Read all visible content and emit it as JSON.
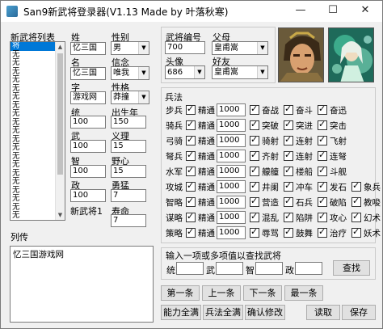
{
  "window": {
    "title": "San9新武将登录器(V1.13 Made by 叶落秋寒)"
  },
  "titlebar": {
    "min": "—",
    "max": "☐",
    "close": "✕"
  },
  "list": {
    "label": "新武将列表",
    "items": [
      "将",
      "无",
      "无",
      "无",
      "无",
      "无",
      "无",
      "无",
      "无",
      "无",
      "无",
      "无",
      "无",
      "无",
      "无",
      "无",
      "无",
      "无",
      "无",
      "无",
      "无",
      "无",
      "无",
      "无",
      "无",
      "无",
      "无",
      "无"
    ]
  },
  "basic": {
    "surname_label": "姓",
    "surname": "忆三国",
    "name_label": "名",
    "name": "忆三国",
    "style_label": "字",
    "style": "游戏网",
    "gender_label": "性别",
    "gender": "男",
    "belief_label": "信念",
    "belief": "唯我",
    "personality_label": "性格",
    "personality": "莽撞",
    "command_label": "统",
    "command": "100",
    "war_label": "武",
    "war": "100",
    "intel_label": "智",
    "intel": "100",
    "politics_label": "政",
    "politics": "100",
    "birth_label": "出生年",
    "birth": "150",
    "righteousness_label": "义理",
    "righteousness": "15",
    "ambition_label": "野心",
    "ambition": "15",
    "bravery_label": "勇猛",
    "bravery": "7",
    "lifespan_label": "寿命",
    "lifespan": "7",
    "general_id_label": "新武将1"
  },
  "codes": {
    "id_label": "武将编号",
    "id": "700",
    "father_label": "父母",
    "father": "皇甫嵩",
    "portrait_label": "头像",
    "portrait": "686",
    "friend_label": "好友",
    "friend": "皇甫嵩"
  },
  "army": {
    "title": "兵法",
    "rows": [
      {
        "unit": "步兵",
        "rank": "精通",
        "value": "1000",
        "s1": "奋战",
        "s2": "奋斗",
        "s3": "奋迅"
      },
      {
        "unit": "骑兵",
        "rank": "精通",
        "value": "1000",
        "s1": "突破",
        "s2": "突进",
        "s3": "突击"
      },
      {
        "unit": "弓骑",
        "rank": "精通",
        "value": "1000",
        "s1": "骑射",
        "s2": "连射",
        "s3": "飞射"
      },
      {
        "unit": "弩兵",
        "rank": "精通",
        "value": "1000",
        "s1": "齐射",
        "s2": "连射",
        "s3": "连弩"
      },
      {
        "unit": "水军",
        "rank": "精通",
        "value": "1000",
        "s1": "艨艟",
        "s2": "楼船",
        "s3": "斗舰"
      },
      {
        "unit": "攻城",
        "rank": "精通",
        "value": "1000",
        "s1": "井阑",
        "s2": "冲车",
        "s3": "发石",
        "s4": "象兵"
      },
      {
        "unit": "智略",
        "rank": "精通",
        "value": "1000",
        "s1": "营造",
        "s2": "石兵",
        "s3": "破陷",
        "s4": "教唆"
      },
      {
        "unit": "谋略",
        "rank": "精通",
        "value": "1000",
        "s1": "混乱",
        "s2": "陷阱",
        "s3": "攻心",
        "s4": "幻术"
      },
      {
        "unit": "策略",
        "rank": "精通",
        "value": "1000",
        "s1": "辱骂",
        "s2": "鼓舞",
        "s3": "治疗",
        "s4": "妖术"
      }
    ]
  },
  "bio": {
    "label": "列传",
    "text": "忆三国游戏网"
  },
  "search": {
    "title": "输入一项或多项值以查找武将",
    "command_label": "统",
    "war_label": "武",
    "intel_label": "智",
    "politics_label": "政",
    "button": "查找"
  },
  "nav": {
    "first": "第一条",
    "prev": "上一条",
    "next": "下一条",
    "last": "最一条"
  },
  "actions": {
    "max_ability": "能力全满",
    "max_army": "兵法全满",
    "confirm": "确认修改",
    "read": "读取",
    "save": "保存"
  }
}
